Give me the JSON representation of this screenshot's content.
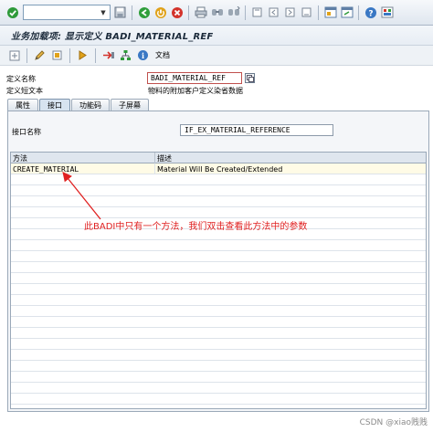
{
  "toolbar": {
    "command_value": "",
    "icons": [
      "check-icon",
      "save-icon",
      "back-icon",
      "exit-icon",
      "cancel-icon",
      "print-icon",
      "find-icon",
      "find-next-icon",
      "first-page-icon",
      "prev-page-icon",
      "next-page-icon",
      "last-page-icon",
      "new-session-icon",
      "shortcut-icon",
      "help-icon",
      "customize-icon"
    ]
  },
  "title": "业务加载项: 显示定义 BADI_MATERIAL_REF",
  "app_toolbar": {
    "icons": [
      "other-object-icon",
      "display-change-icon",
      "activate-icon",
      "where-used-icon",
      "navigate-icon",
      "hierarchy-icon",
      "info-icon"
    ],
    "doc_label": "文档"
  },
  "header": {
    "def_name_label": "定义名称",
    "def_name_value": "BADI_MATERIAL_REF",
    "short_text_label": "定义短文本",
    "short_text_value": "物料的附加客户定义染省数据"
  },
  "tabs": [
    {
      "label": "属性",
      "active": false
    },
    {
      "label": "接口",
      "active": true
    },
    {
      "label": "功能码",
      "active": false
    },
    {
      "label": "子屏幕",
      "active": false
    }
  ],
  "interface": {
    "label": "接口名称",
    "value": "IF_EX_MATERIAL_REFERENCE"
  },
  "table": {
    "col_method": "方法",
    "col_desc": "描述",
    "rows": [
      {
        "method": "CREATE_MATERIAL",
        "desc": "Material Will Be Created/Extended"
      }
    ]
  },
  "annotation": "此BADI中只有一个方法，我们双击查看此方法中的参数",
  "watermark": "CSDN @xiao贱贱",
  "colors": {
    "annotation": "#e02020",
    "title_bar": "#e7edf4",
    "panel": "#f4f6f9"
  }
}
